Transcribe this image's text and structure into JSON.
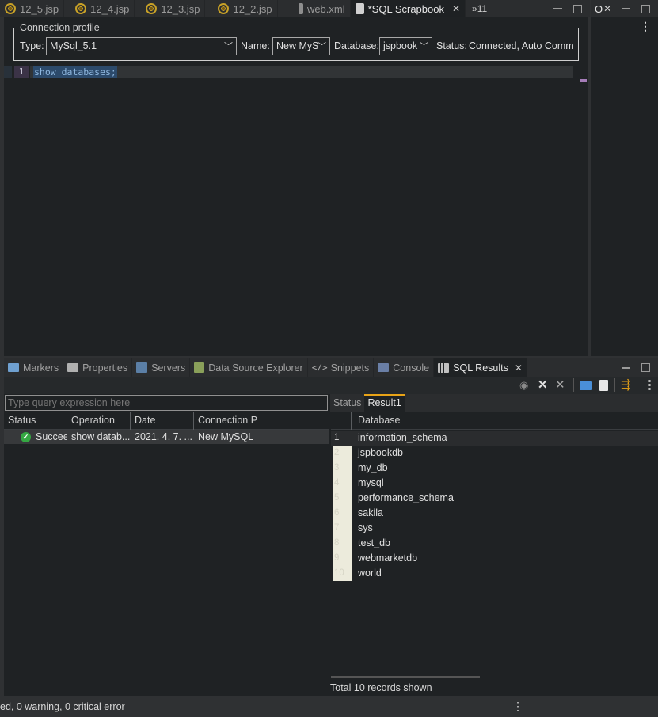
{
  "editor_tabs": [
    {
      "label": "12_5.jsp",
      "icon": "globe-icon"
    },
    {
      "label": "12_4.jsp",
      "icon": "globe-icon"
    },
    {
      "label": "12_3.jsp",
      "icon": "globe-icon"
    },
    {
      "label": "12_2.jsp",
      "icon": "globe-icon"
    },
    {
      "label": "web.xml",
      "icon": "xml-file-icon"
    },
    {
      "label": "*SQL Scrapbook",
      "icon": "sql-scrapbook-icon",
      "active": true
    }
  ],
  "editor_tabs_overflow": "»11",
  "side_tab_label": "O",
  "connection_profile": {
    "legend": "Connection profile",
    "type_label": "Type:",
    "type_value": "MySql_5.1",
    "name_label": "Name:",
    "name_value": "New MyS",
    "database_label": "Database:",
    "database_value": "jspbook",
    "status_label": "Status:",
    "status_value": "Connected, Auto Comm"
  },
  "editor": {
    "line_number": "1",
    "code": "show databases;"
  },
  "view_tabs": [
    {
      "label": "Markers",
      "icon": "markers-icon",
      "color": "#6fa0d0"
    },
    {
      "label": "Properties",
      "icon": "properties-icon",
      "color": "#b0b0b0"
    },
    {
      "label": "Servers",
      "icon": "servers-icon",
      "color": "#5b7fa6"
    },
    {
      "label": "Data Source Explorer",
      "icon": "data-source-icon",
      "color": "#8aa05a"
    },
    {
      "label": "Snippets",
      "icon": "snippets-icon",
      "color": "#b0b0b0"
    },
    {
      "label": "Console",
      "icon": "console-icon",
      "color": "#6a7fa6"
    },
    {
      "label": "SQL Results",
      "icon": "sql-results-icon",
      "color": "#c0c0c0",
      "active": true
    }
  ],
  "history": {
    "query_placeholder": "Type query expression here",
    "columns": [
      "Status",
      "Operation",
      "Date",
      "Connection P"
    ],
    "row": {
      "status": "Succeeded",
      "operation": "show datab...",
      "date": "2021. 4. 7. ...",
      "connection": "New MySQL"
    }
  },
  "results": {
    "tabs": [
      "Status",
      "Result1"
    ],
    "column": "Database",
    "rows": [
      {
        "n": "1",
        "v": "information_schema"
      },
      {
        "n": "2",
        "v": "jspbookdb"
      },
      {
        "n": "3",
        "v": "my_db"
      },
      {
        "n": "4",
        "v": "mysql"
      },
      {
        "n": "5",
        "v": "performance_schema"
      },
      {
        "n": "6",
        "v": "sakila"
      },
      {
        "n": "7",
        "v": "sys"
      },
      {
        "n": "8",
        "v": "test_db"
      },
      {
        "n": "9",
        "v": "webmarketdb"
      },
      {
        "n": "10",
        "v": "world"
      }
    ],
    "footer": "Total 10 records shown"
  },
  "status_bar": "ed, 0 warning, 0 critical error",
  "colors": {
    "accent": "#e8a317",
    "success": "#35a843",
    "selection": "#2c4a6b"
  }
}
